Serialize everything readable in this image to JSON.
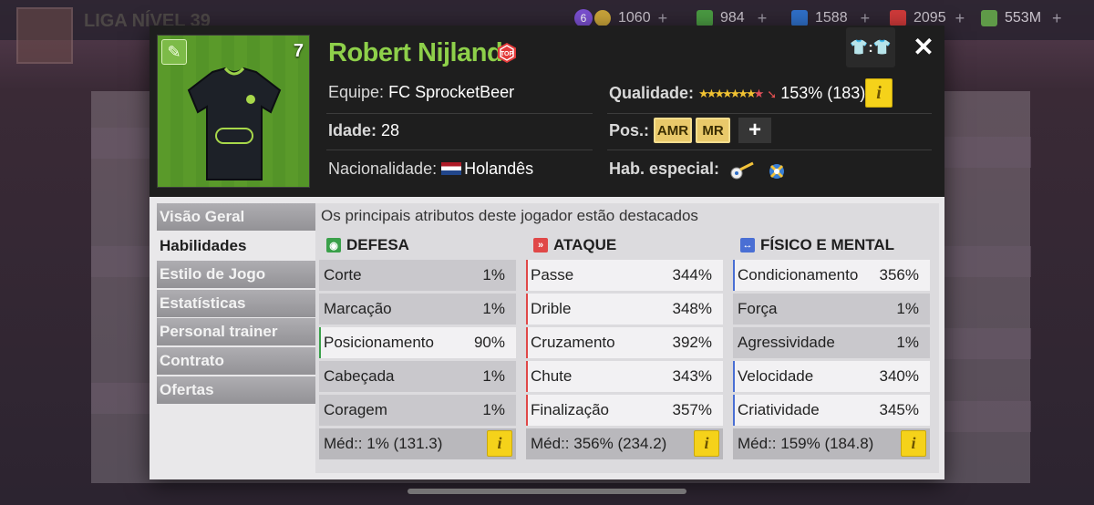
{
  "background": {
    "league_text": "LIGA NÍVEL 39"
  },
  "currency": [
    {
      "id": "tokens",
      "badge": "6",
      "value": "1060",
      "color": "#d4b13a"
    },
    {
      "id": "cash",
      "value": "984",
      "color": "#57a84a"
    },
    {
      "id": "energy",
      "value": "1588",
      "color": "#3a7fd4"
    },
    {
      "id": "health",
      "value": "2095",
      "color": "#d44040"
    },
    {
      "id": "money",
      "value": "553M",
      "color": "#6aa84f"
    }
  ],
  "player": {
    "name": "Robert Nijland",
    "shirt_number": "7",
    "team_label": "Equipe:",
    "team": "FC SprocketBeer",
    "age_label": "Idade:",
    "age": "28",
    "nationality_label": "Nacionalidade:",
    "nationality": "Holandês",
    "quality_label": "Qualidade:",
    "quality_value": "153% (183)",
    "quality_stars": 7.5,
    "positions_label": "Pos.:",
    "positions": [
      "AMR",
      "MR"
    ],
    "special_label": "Hab. especial:",
    "special_abilities": [
      "skill-icon-1",
      "skill-icon-2"
    ]
  },
  "nav": [
    {
      "label": "Visão Geral",
      "active": false
    },
    {
      "label": "Habilidades",
      "active": true
    },
    {
      "label": "Estilo de Jogo",
      "active": false
    },
    {
      "label": "Estatísticas",
      "active": false
    },
    {
      "label": "Personal trainer",
      "active": false
    },
    {
      "label": "Contrato",
      "active": false
    },
    {
      "label": "Ofertas",
      "active": false
    }
  ],
  "skills": {
    "subtitle": "Os principais atributos deste jogador estão destacados",
    "columns": [
      {
        "title": "DEFESA",
        "color": "#3aa04a",
        "rows": [
          {
            "name": "Corte",
            "value": "1%",
            "highlight": false
          },
          {
            "name": "Marcação",
            "value": "1%",
            "highlight": false
          },
          {
            "name": "Posicionamento",
            "value": "90%",
            "highlight": true
          },
          {
            "name": "Cabeçada",
            "value": "1%",
            "highlight": false
          },
          {
            "name": "Coragem",
            "value": "1%",
            "highlight": false
          }
        ],
        "average": "Méd:: 1% (131.3)"
      },
      {
        "title": "ATAQUE",
        "color": "#e04848",
        "rows": [
          {
            "name": "Passe",
            "value": "344%",
            "highlight": true
          },
          {
            "name": "Drible",
            "value": "348%",
            "highlight": true
          },
          {
            "name": "Cruzamento",
            "value": "392%",
            "highlight": true
          },
          {
            "name": "Chute",
            "value": "343%",
            "highlight": true
          },
          {
            "name": "Finalização",
            "value": "357%",
            "highlight": true
          }
        ],
        "average": "Méd:: 356% (234.2)"
      },
      {
        "title": "FÍSICO E MENTAL",
        "color": "#4a6fd4",
        "rows": [
          {
            "name": "Condicionamento",
            "value": "356%",
            "highlight": true
          },
          {
            "name": "Força",
            "value": "1%",
            "highlight": false
          },
          {
            "name": "Agressividade",
            "value": "1%",
            "highlight": false
          },
          {
            "name": "Velocidade",
            "value": "340%",
            "highlight": true
          },
          {
            "name": "Criatividade",
            "value": "345%",
            "highlight": true
          }
        ],
        "average": "Méd:: 159% (184.8)"
      }
    ]
  }
}
